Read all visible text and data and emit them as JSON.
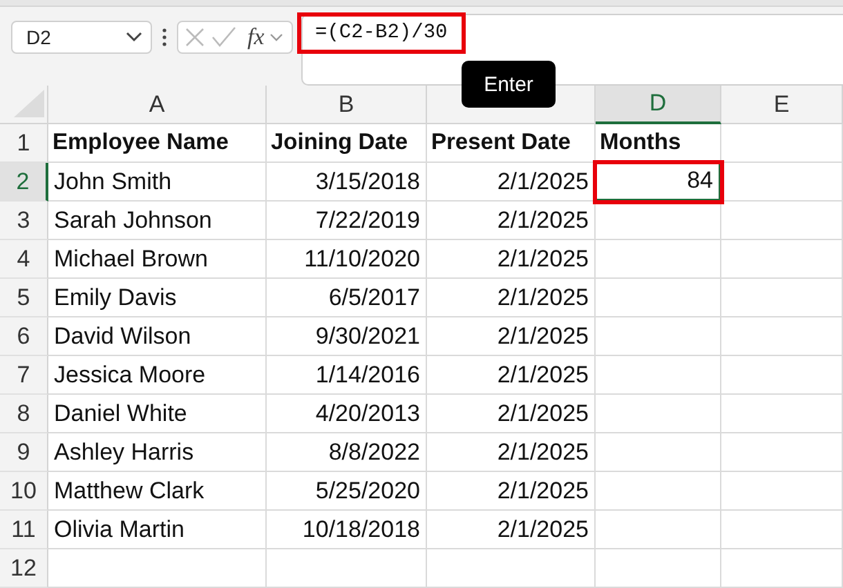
{
  "name_box": {
    "value": "D2"
  },
  "formula_bar": {
    "function_label": "fx",
    "formula": "=(C2-B2)/30",
    "highlighted": true
  },
  "tooltip": {
    "text": "Enter"
  },
  "column_headers": [
    {
      "label": "A",
      "selected": false
    },
    {
      "label": "B",
      "selected": false
    },
    {
      "selected": false
    },
    {
      "label": "D",
      "selected": true
    },
    {
      "label": "E",
      "selected": false
    }
  ],
  "rows": [
    {
      "number": "1",
      "selected": false,
      "header": true,
      "cells": [
        "Employee Name",
        "Joining Date",
        "Present Date",
        "Months",
        ""
      ]
    },
    {
      "number": "2",
      "selected": true,
      "cells": [
        "John Smith",
        "3/15/2018",
        "2/1/2025",
        "84",
        ""
      ]
    },
    {
      "number": "3",
      "selected": false,
      "cells": [
        "Sarah Johnson",
        "7/22/2019",
        "2/1/2025",
        "",
        ""
      ]
    },
    {
      "number": "4",
      "selected": false,
      "cells": [
        "Michael Brown",
        "11/10/2020",
        "2/1/2025",
        "",
        ""
      ]
    },
    {
      "number": "5",
      "selected": false,
      "cells": [
        "Emily Davis",
        "6/5/2017",
        "2/1/2025",
        "",
        ""
      ]
    },
    {
      "number": "6",
      "selected": false,
      "cells": [
        "David Wilson",
        "9/30/2021",
        "2/1/2025",
        "",
        ""
      ]
    },
    {
      "number": "7",
      "selected": false,
      "cells": [
        "Jessica Moore",
        "1/14/2016",
        "2/1/2025",
        "",
        ""
      ]
    },
    {
      "number": "8",
      "selected": false,
      "cells": [
        "Daniel White",
        "4/20/2013",
        "2/1/2025",
        "",
        ""
      ]
    },
    {
      "number": "9",
      "selected": false,
      "cells": [
        "Ashley Harris",
        "8/8/2022",
        "2/1/2025",
        "",
        ""
      ]
    },
    {
      "number": "10",
      "selected": false,
      "cells": [
        "Matthew Clark",
        "5/25/2020",
        "2/1/2025",
        "",
        ""
      ]
    },
    {
      "number": "11",
      "selected": false,
      "cells": [
        "Olivia Martin",
        "10/18/2018",
        "2/1/2025",
        "",
        ""
      ]
    },
    {
      "number": "12",
      "selected": false,
      "cells": [
        "",
        "",
        "",
        "",
        ""
      ]
    }
  ]
}
